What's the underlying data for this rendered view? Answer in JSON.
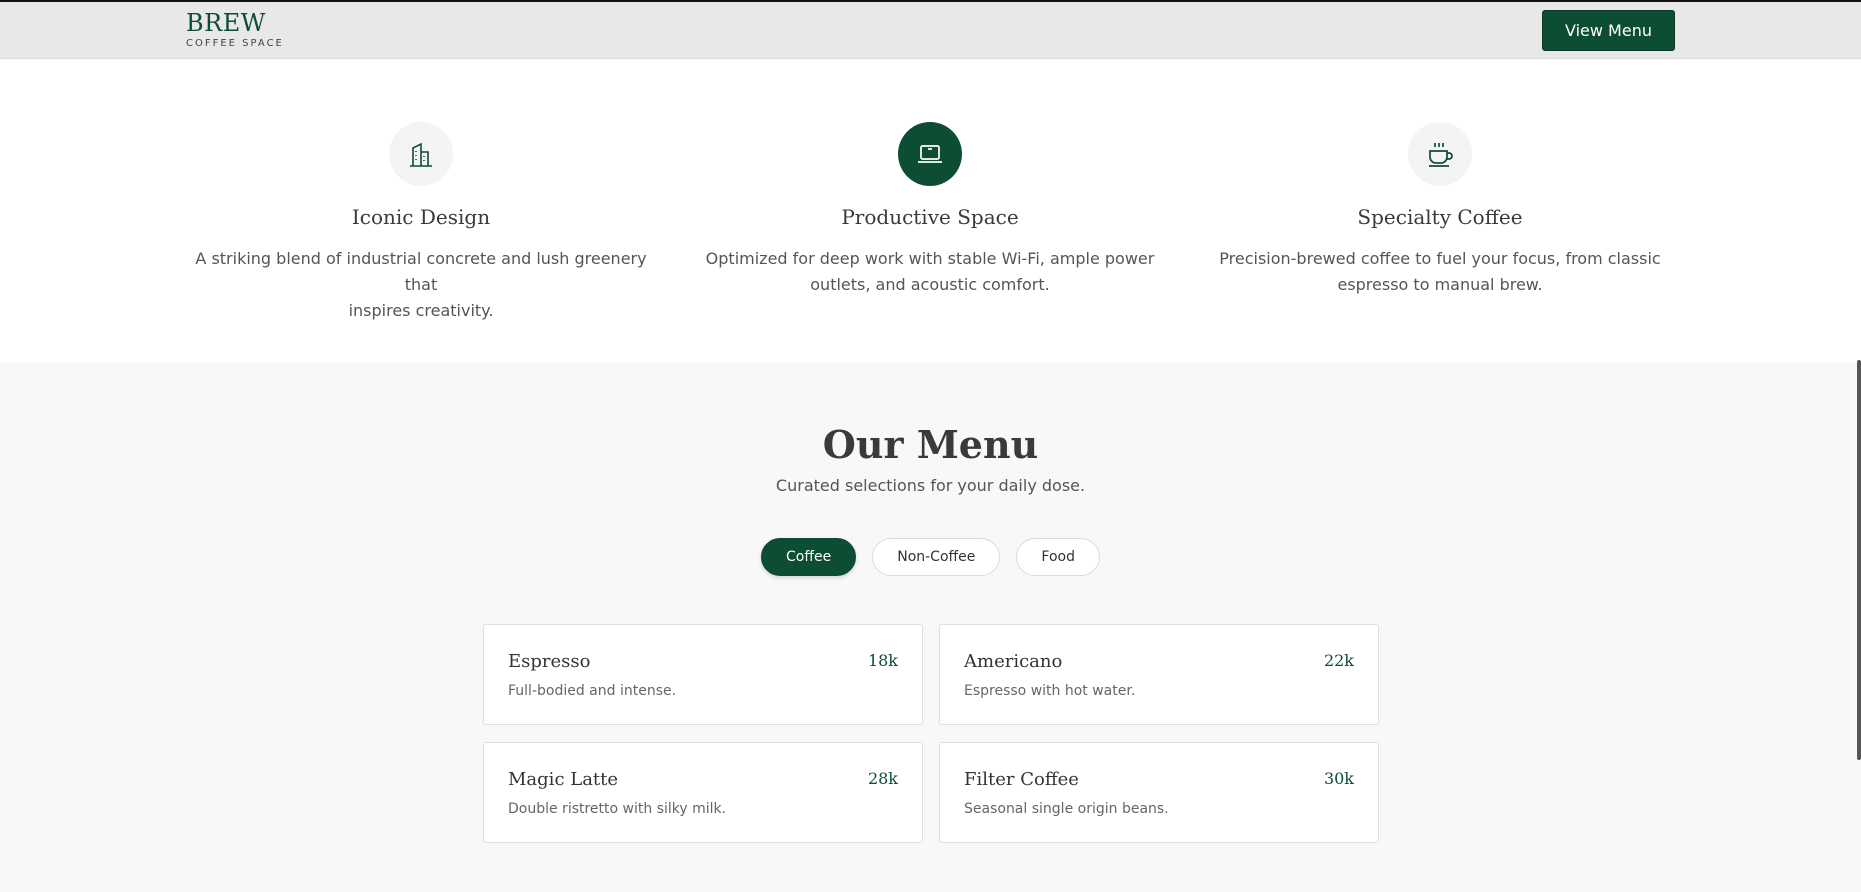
{
  "header": {
    "brand_name": "BREW",
    "brand_sub": "COFFEE SPACE",
    "view_menu_label": "View Menu"
  },
  "features": [
    {
      "icon": "building-icon",
      "title": "Iconic Design",
      "desc_line1": "A striking blend of industrial concrete and lush greenery that",
      "desc_line2": "inspires creativity."
    },
    {
      "icon": "laptop-icon",
      "title": "Productive Space",
      "desc_line1": "Optimized for deep work with stable Wi-Fi, ample power",
      "desc_line2": "outlets, and acoustic comfort."
    },
    {
      "icon": "coffee-cup-icon",
      "title": "Specialty Coffee",
      "desc_line1": "Precision-brewed coffee to fuel your focus, from classic",
      "desc_line2": "espresso to manual brew."
    }
  ],
  "menu": {
    "title": "Our Menu",
    "subtitle": "Curated selections for your daily dose.",
    "tabs": [
      {
        "label": "Coffee",
        "active": true
      },
      {
        "label": "Non-Coffee",
        "active": false
      },
      {
        "label": "Food",
        "active": false
      }
    ],
    "items": [
      {
        "name": "Espresso",
        "price": "18k",
        "desc": "Full-bodied and intense."
      },
      {
        "name": "Americano",
        "price": "22k",
        "desc": "Espresso with hot water."
      },
      {
        "name": "Magic Latte",
        "price": "28k",
        "desc": "Double ristretto with silky milk."
      },
      {
        "name": "Filter Coffee",
        "price": "30k",
        "desc": "Seasonal single origin beans."
      }
    ]
  },
  "colors": {
    "brand_green": "#0d4d33",
    "header_bg": "#e8e8e8",
    "section_bg": "#f8f8f8"
  }
}
